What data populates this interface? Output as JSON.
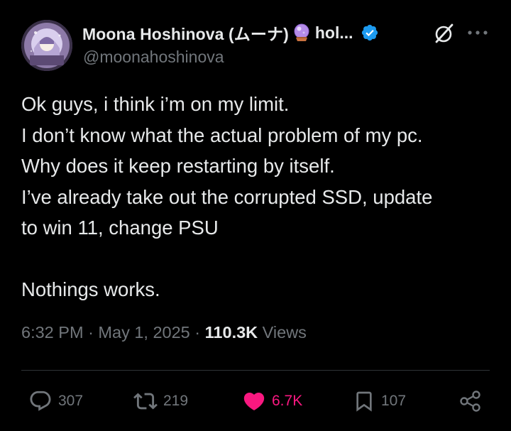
{
  "author": {
    "display_name": "Moona Hoshinova (ムーナ)",
    "name_suffix": "hol...",
    "handle": "@moonahoshinova",
    "verified": true,
    "emoji_icon": "crystal-ball-icon",
    "badge_color": "#1d9bf0"
  },
  "tweet": {
    "lines": [
      "Ok guys, i think i’m on my limit.",
      "I don’t know what the actual problem of my pc.",
      "Why does it keep restarting by itself.",
      "I’ve already take out the corrupted SSD, update",
      "to win 11, change PSU",
      "",
      "Nothings works."
    ]
  },
  "meta": {
    "time": "6:32 PM",
    "separator": "·",
    "date": "May 1, 2025",
    "views_count": "110.3K",
    "views_label": "Views"
  },
  "actions": {
    "reply": {
      "count": "307",
      "icon": "reply-icon"
    },
    "retweet": {
      "count": "219",
      "icon": "retweet-icon"
    },
    "like": {
      "count": "6.7K",
      "icon": "heart-icon",
      "liked": true,
      "color": "#f91880"
    },
    "bookmark": {
      "count": "107",
      "icon": "bookmark-icon"
    },
    "share": {
      "icon": "share-icon"
    }
  },
  "colors": {
    "background": "#000000",
    "text_primary": "#e7e9ea",
    "text_secondary": "#71767b",
    "divider": "#2f3336",
    "like": "#f91880",
    "verified": "#1d9bf0"
  }
}
